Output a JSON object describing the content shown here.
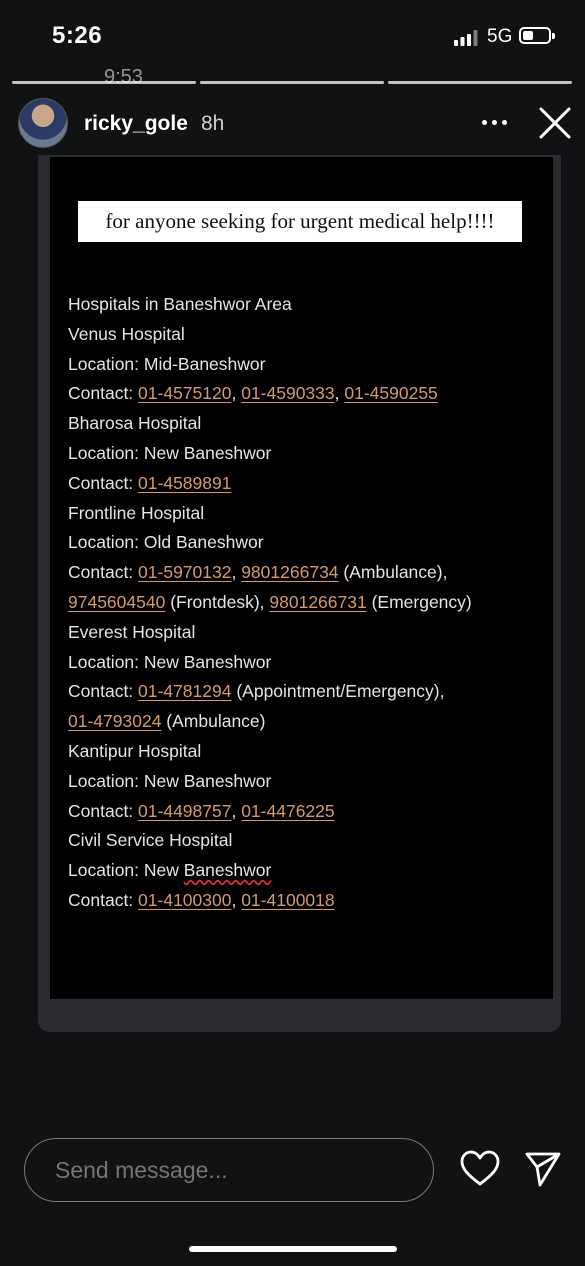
{
  "status_bar": {
    "time": "5:26",
    "network": "5G",
    "overlay_time": "9:53"
  },
  "story": {
    "username": "ricky_gole",
    "time_ago": "8h",
    "heading": "for anyone seeking for urgent medical help!!!!",
    "lines": [
      {
        "text": "Hospitals in Baneshwor Area"
      },
      {
        "text": "Venus Hospital"
      },
      {
        "text": "Location: Mid-Baneshwor"
      },
      {
        "parts": [
          {
            "t": "Contact: "
          },
          {
            "t": "01-4575120",
            "link": true
          },
          {
            "t": ", "
          },
          {
            "t": "01-4590333",
            "link": true
          },
          {
            "t": ", "
          },
          {
            "t": "01-4590255",
            "link": true
          }
        ]
      },
      {
        "text": "Bharosa Hospital"
      },
      {
        "text": "Location: New Baneshwor"
      },
      {
        "parts": [
          {
            "t": "Contact: "
          },
          {
            "t": "01-4589891",
            "link": true
          }
        ]
      },
      {
        "text": "Frontline Hospital"
      },
      {
        "text": "Location: Old Baneshwor"
      },
      {
        "parts": [
          {
            "t": "Contact: "
          },
          {
            "t": "01-5970132",
            "link": true
          },
          {
            "t": ", "
          },
          {
            "t": "9801266734",
            "link": true
          },
          {
            "t": " (Ambulance),"
          }
        ]
      },
      {
        "parts": [
          {
            "t": "9745604540",
            "link": true
          },
          {
            "t": " (Frontdesk), "
          },
          {
            "t": "9801266731",
            "link": true
          },
          {
            "t": " (Emergency)"
          }
        ]
      },
      {
        "text": "Everest Hospital"
      },
      {
        "text": "Location: New Baneshwor"
      },
      {
        "parts": [
          {
            "t": "Contact: "
          },
          {
            "t": "01-4781294",
            "link": true
          },
          {
            "t": " (Appointment/Emergency),"
          }
        ]
      },
      {
        "parts": [
          {
            "t": "01-4793024",
            "link": true
          },
          {
            "t": " (Ambulance)"
          }
        ]
      },
      {
        "text": "Kantipur Hospital"
      },
      {
        "text": "Location: New Baneshwor"
      },
      {
        "parts": [
          {
            "t": "Contact: "
          },
          {
            "t": "01-4498757",
            "link": true
          },
          {
            "t": ", "
          },
          {
            "t": "01-4476225",
            "link": true
          }
        ]
      },
      {
        "text": "Civil Service Hospital"
      },
      {
        "parts": [
          {
            "t": "Location: New "
          },
          {
            "t": "Baneshwor",
            "spell": true
          }
        ]
      },
      {
        "parts": [
          {
            "t": "Contact: "
          },
          {
            "t": "01-4100300",
            "link": true
          },
          {
            "t": ", "
          },
          {
            "t": "01-4100018",
            "link": true
          }
        ]
      }
    ]
  },
  "message_bar": {
    "placeholder": "Send message..."
  },
  "colors": {
    "phone_link": "#d29a6e",
    "background": "#101214"
  },
  "icons": [
    "cellular-signal-icon",
    "battery-icon",
    "more-icon",
    "close-icon",
    "heart-icon",
    "send-icon"
  ]
}
